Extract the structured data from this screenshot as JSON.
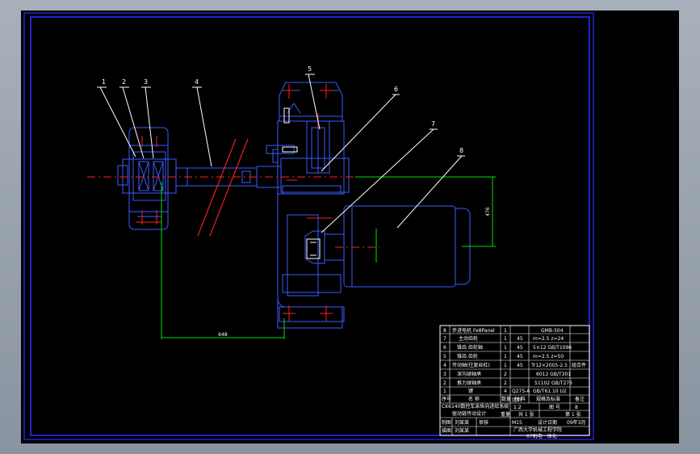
{
  "colors": {
    "background": "#000000",
    "frame": "#2b2bff",
    "part": "#3a5cff",
    "centerline": "#ff2020",
    "annotation": "#ffffff",
    "dimension": "#00e000"
  },
  "balloons": [
    "1",
    "2",
    "3",
    "4",
    "5",
    "6",
    "7",
    "8"
  ],
  "dimensions": {
    "horizontal": "648",
    "vertical": "476"
  },
  "bom": [
    {
      "no": "8",
      "name": "步进电机 Fe8Panel",
      "qty": "1",
      "material": "",
      "spec": "GMB-504",
      "note": ""
    },
    {
      "no": "7",
      "name": "主动齿轮",
      "qty": "1",
      "material": "45",
      "spec": "m=2.5 z=24",
      "note": ""
    },
    {
      "no": "6",
      "name": "锥齿 齿轮轴",
      "qty": "1",
      "material": "45",
      "spec": "5×12 GB/T1096",
      "note": ""
    },
    {
      "no": "5",
      "name": "锥齿 齿轮",
      "qty": "1",
      "material": "45",
      "spec": "m=2.5 z=50",
      "note": ""
    },
    {
      "no": "4",
      "name": "传动轴(往复丝杠)",
      "qty": "1",
      "material": "45",
      "spec": "Tr12×2005-2.5",
      "note": "组合件"
    },
    {
      "no": "3",
      "name": "深沟球轴承",
      "qty": "2",
      "material": "",
      "spec": "6012 GB/T301",
      "note": ""
    },
    {
      "no": "2",
      "name": "推力球轴承",
      "qty": "2",
      "material": "",
      "spec": "51102 GB/T276",
      "note": ""
    },
    {
      "no": "1",
      "name": "键",
      "qty": "4",
      "material": "Q275-A",
      "spec": "GB/T61.10 U2",
      "note": ""
    }
  ],
  "bom_header": {
    "no": "序号",
    "name": "名 称",
    "qty": "数量",
    "material": "材 料",
    "spec": "规格及标准",
    "note": "备注"
  },
  "title_block": {
    "project_name": "CK6140数控车床纵向进给系统",
    "subtitle": "驱动链传动设计",
    "scale_label": "比例",
    "scale": "1:2",
    "sheet_label": "图 号",
    "sheet": "8",
    "count_label": "共 1 张",
    "page_label": "第 1 张",
    "designer_label": "制图",
    "designer": "刘某某",
    "checker_label": "描图",
    "checker": "刘某某",
    "reviewer_label": "审核",
    "weight_label": "重量",
    "weight": "M15",
    "date_label": "设计日期",
    "date": "09年3月",
    "school": "广西大学机械工程学院",
    "major": "07机电一体化"
  }
}
